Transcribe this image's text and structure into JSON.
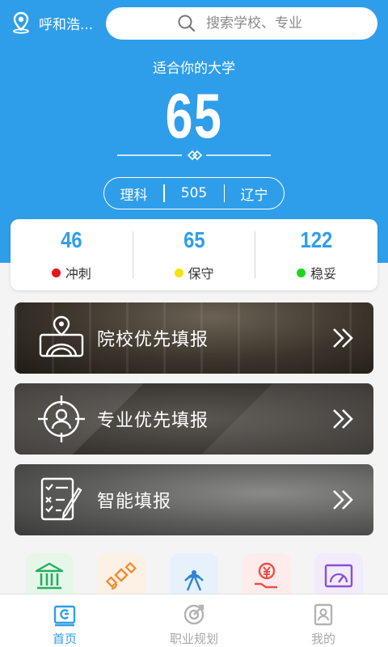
{
  "header": {
    "location": "呼和浩...",
    "search_placeholder": "搜索学校、专业"
  },
  "score_section": {
    "subtitle": "适合你的大学",
    "count": "65",
    "subject": "理科",
    "score": "505",
    "province": "辽宁"
  },
  "stats": [
    {
      "value": "46",
      "label": "冲刺",
      "color": "#e8141a"
    },
    {
      "value": "65",
      "label": "保守",
      "color": "#f3e40f"
    },
    {
      "value": "122",
      "label": "稳妥",
      "color": "#1fd41f"
    }
  ],
  "cards": [
    {
      "label": "院校优先填报",
      "icon": "school-screen-icon"
    },
    {
      "label": "专业优先填报",
      "icon": "person-target-icon"
    },
    {
      "label": "智能填报",
      "icon": "checklist-pen-icon"
    }
  ],
  "quick_icons": [
    {
      "icon": "bank-building-icon",
      "bg": "#e6f7ea",
      "color": "#22b05a"
    },
    {
      "icon": "satellite-icon",
      "bg": "#fdf0e4",
      "color": "#f08c2a"
    },
    {
      "icon": "signal-tower-icon",
      "bg": "#e6f1fb",
      "color": "#2f86d6"
    },
    {
      "icon": "yuan-fee-icon",
      "bg": "#fdeceb",
      "color": "#e8504a"
    },
    {
      "icon": "gauge-board-icon",
      "bg": "#f1ebfb",
      "color": "#8a4fd6"
    }
  ],
  "tabs": [
    {
      "label": "首页",
      "active": true
    },
    {
      "label": "职业规划",
      "active": false
    },
    {
      "label": "我的",
      "active": false
    }
  ],
  "colors": {
    "primary": "#2f9eea"
  }
}
